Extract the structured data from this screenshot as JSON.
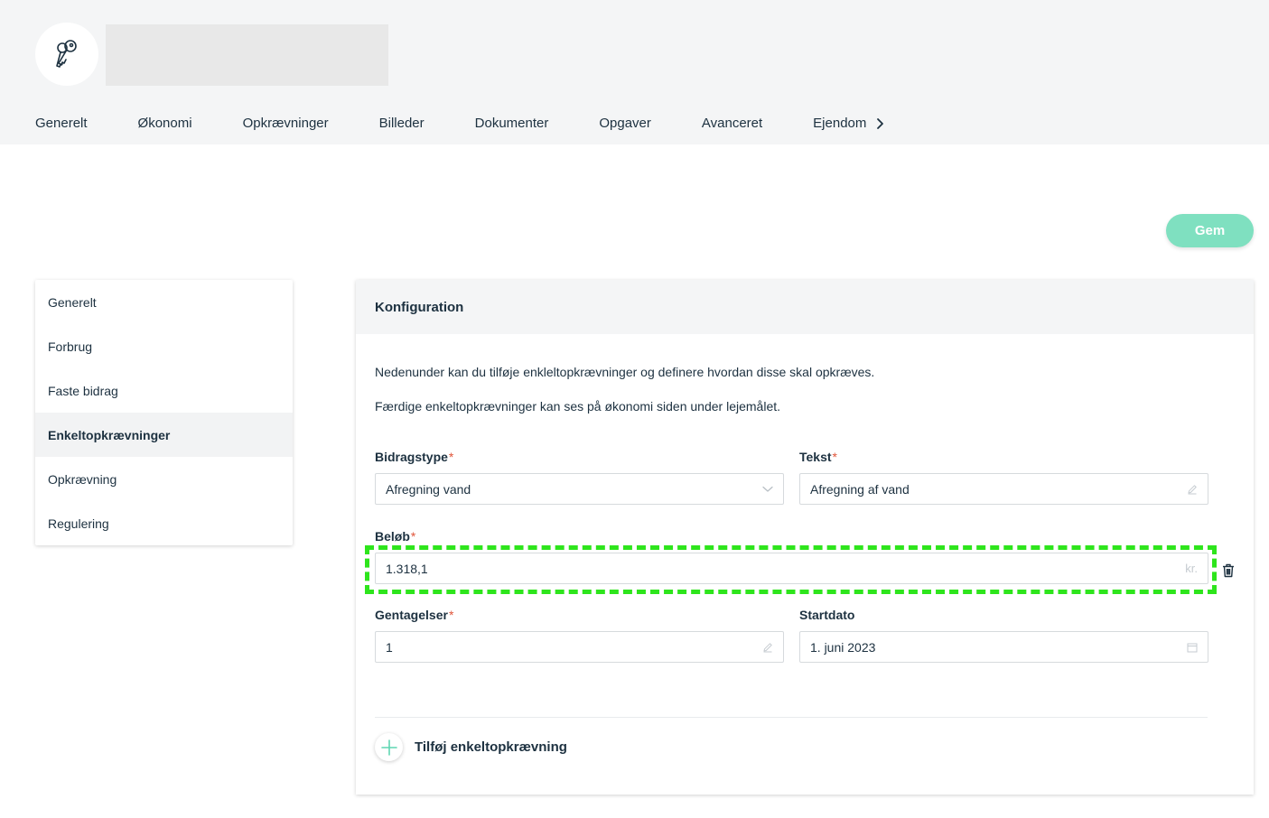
{
  "header": {
    "avatar_icon": "keys-icon",
    "tabs": [
      "Generelt",
      "Økonomi",
      "Opkrævninger",
      "Billeder",
      "Dokumenter",
      "Opgaver",
      "Avanceret",
      "Ejendom"
    ],
    "more_icon": "chevron-right-icon"
  },
  "actions": {
    "save_label": "Gem"
  },
  "colors": {
    "accent": "#7fe0c0",
    "text": "#1d3140",
    "required": "#e0553a",
    "highlight": "#2ee51c"
  },
  "sidebar": {
    "items": [
      {
        "label": "Generelt",
        "active": false
      },
      {
        "label": "Forbrug",
        "active": false
      },
      {
        "label": "Faste bidrag",
        "active": false
      },
      {
        "label": "Enkeltopkrævninger",
        "active": true
      },
      {
        "label": "Opkrævning",
        "active": false
      },
      {
        "label": "Regulering",
        "active": false
      }
    ]
  },
  "card": {
    "title": "Konfiguration",
    "description1": "Nedenunder kan du tilføje enkleltopkrævninger og definere hvordan disse skal opkræves.",
    "description2": "Færdige enkeltopkrævninger kan ses på økonomi siden under lejemålet.",
    "fields": {
      "bidragstype": {
        "label": "Bidragstype",
        "value": "Afregning vand",
        "required": true
      },
      "tekst": {
        "label": "Tekst",
        "value": "Afregning af vand",
        "required": true
      },
      "belob": {
        "label": "Beløb",
        "value": "1.318,1",
        "suffix": "kr.",
        "required": true
      },
      "gentagelser": {
        "label": "Gentagelser",
        "value": "1",
        "required": true
      },
      "startdato": {
        "label": "Startdato",
        "value": "1. juni 2023",
        "required": false
      }
    },
    "add_label": "Tilføj enkeltopkrævning",
    "required_mark": "*"
  }
}
